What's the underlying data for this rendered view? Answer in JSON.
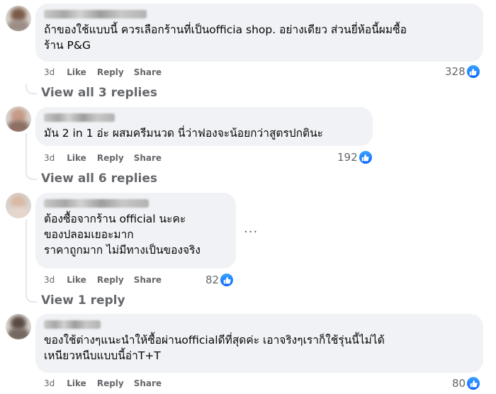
{
  "comments": [
    {
      "text": "ถ้าของใช้แบบนี้ ควรเลือกร้านที่เป็นofficia shop. อย่างเดียว ส่วนยี่ห้อนี้ผมซื้อ\nร้าน P&G",
      "time": "3d",
      "like": "Like",
      "reply": "Reply",
      "share": "Share",
      "reaction_count": "328",
      "view_replies": "View all 3 replies"
    },
    {
      "text": "มัน 2 in 1 อ่ะ ผสมครีมนวด นี่ว่าฟองจะน้อยกว่าสูตรปกตินะ",
      "time": "3d",
      "like": "Like",
      "reply": "Reply",
      "share": "Share",
      "reaction_count": "192",
      "view_replies": "View all 6 replies"
    },
    {
      "text": "ต้องซื้อจากร้าน official นะคะ\nของปลอมเยอะมาก\nราคาถูกมาก ไม่มีทางเป็นของจริง",
      "time": "3d",
      "like": "Like",
      "reply": "Reply",
      "share": "Share",
      "reaction_count": "82",
      "view_replies": "View 1 reply",
      "more": "..."
    },
    {
      "text": "ของใช้ต่างๆแนะนำให้ซื้อผ่านofficialดีที่สุดค่ะ เอาจริงๆเราก็ใช้รุ่นนี้ไม่ได้\nเหนียวหนืบแบบนี้อ่าT+T",
      "time": "3d",
      "like": "Like",
      "reply": "Reply",
      "share": "Share",
      "reaction_count": "80"
    }
  ],
  "colors": {
    "bubble": "#f0f2f5",
    "secondary_text": "#65676b",
    "like_blue": "#0866ff"
  },
  "icons": {
    "reaction": "thumbs-up-icon",
    "more": "more-options-icon"
  }
}
